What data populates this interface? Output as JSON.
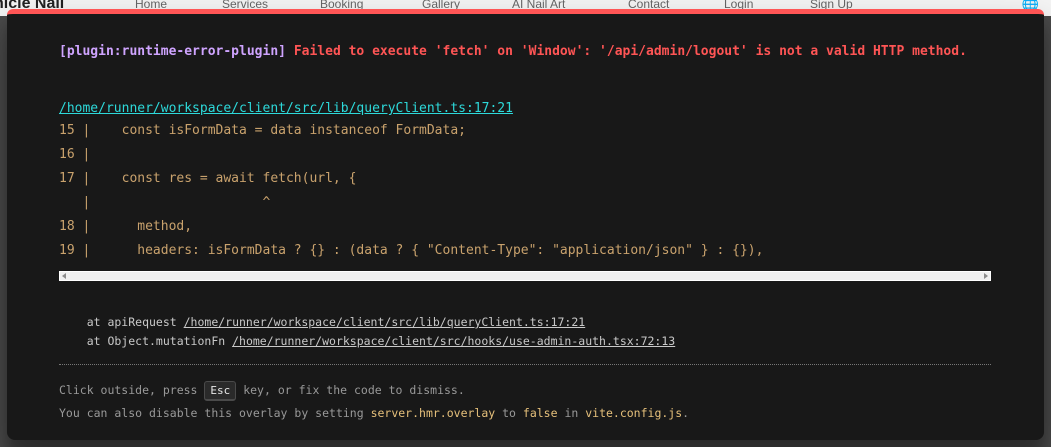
{
  "background": {
    "brand": "nicle Nail",
    "nav_links": [
      "Home",
      "Services",
      "Booking",
      "Gallery",
      "AI Nail Art",
      "Contact",
      "Login",
      "Sign Up"
    ],
    "globe_icon": "globe-icon"
  },
  "error": {
    "plugin": "[plugin:runtime-error-plugin]",
    "message": "Failed to execute 'fetch' on 'Window': '/api/admin/logout' is not a valid HTTP method.",
    "file": "/home/runner/workspace/client/src/lib/queryClient.ts:17:21",
    "frame": [
      "15 |    const isFormData = data instanceof FormData;",
      "16 |",
      "17 |    const res = await fetch(url, {",
      "   |                      ^",
      "18 |      method,",
      "19 |      headers: isFormData ? {} : (data ? { \"Content-Type\": \"application/json\" } : {}),"
    ],
    "stack": [
      {
        "prefix": "    at apiRequest ",
        "path": "/home/runner/workspace/client/src/lib/queryClient.ts:17:21"
      },
      {
        "prefix": "    at Object.mutationFn ",
        "path": "/home/runner/workspace/client/src/hooks/use-admin-auth.tsx:72:13"
      }
    ]
  },
  "tip": {
    "line1_before": "Click outside, press ",
    "key": "Esc",
    "line1_after": " key, or fix the code to dismiss.",
    "line2_before": "You can also disable this overlay by setting ",
    "setting": "server.hmr.overlay",
    "line2_mid": " to ",
    "value": "false",
    "line2_mid2": " in ",
    "config_file": "vite.config.js",
    "line2_end": "."
  },
  "colors": {
    "accent_red": "#ff5555",
    "plugin_purple": "#cfa4ff",
    "link_cyan": "#2dd9da",
    "code_yellow": "#c9a26d"
  }
}
